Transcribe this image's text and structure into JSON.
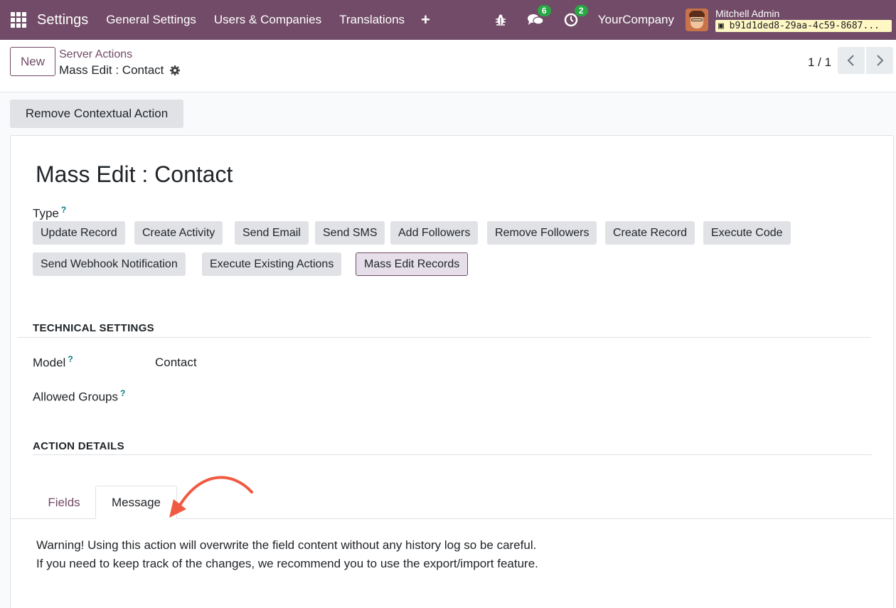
{
  "navbar": {
    "app_name": "Settings",
    "menu": [
      "General Settings",
      "Users & Companies",
      "Translations"
    ],
    "plus": "+",
    "messages_badge": "6",
    "activities_badge": "2",
    "company": "YourCompany",
    "user": "Mitchell Admin",
    "database": "b91d1ded8-29aa-4c59-8687..."
  },
  "control": {
    "new_label": "New",
    "breadcrumb": "Server Actions",
    "record": "Mass Edit : Contact",
    "pager": "1 / 1"
  },
  "remove_action_label": "Remove Contextual Action",
  "form": {
    "title": "Mass Edit : Contact",
    "type_label": "Type",
    "help": "?",
    "types": [
      "Update Record",
      "Create Activity",
      "Send Email",
      "Send SMS",
      "Add Followers",
      "Remove Followers",
      "Create Record",
      "Execute Code",
      "Send Webhook Notification",
      "Execute Existing Actions",
      "Mass Edit Records"
    ],
    "selected_type": "Mass Edit Records",
    "technical_settings": "TECHNICAL SETTINGS",
    "model_label": "Model",
    "model_value": "Contact",
    "groups_label": "Allowed Groups",
    "action_details": "ACTION DETAILS",
    "tabs": [
      "Fields",
      "Message"
    ],
    "active_tab": "Message",
    "message_lines": [
      "Warning! Using this action will overwrite the field content without any history log so be careful.",
      "If you need to keep track of the changes, we recommend you to use the export/import feature."
    ]
  },
  "colors": {
    "brand": "#714b67",
    "annotation_arrow": "#f05a41",
    "badge": "#28a745"
  }
}
